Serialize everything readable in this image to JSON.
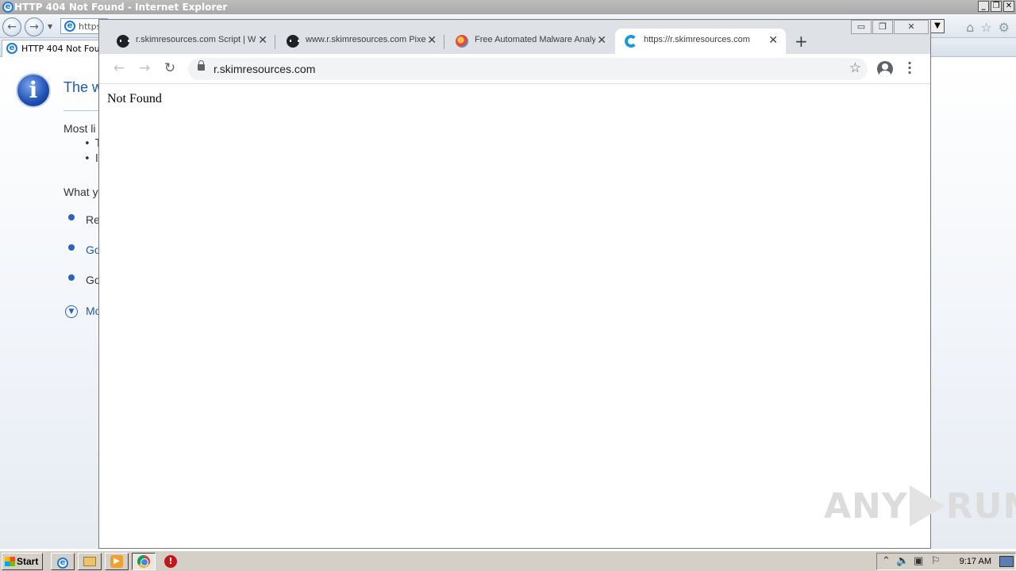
{
  "ie": {
    "window_title": "HTTP 404 Not Found - Internet Explorer",
    "address_value": "https:",
    "tab_label": "HTTP 404 Not Found",
    "heading": "The w",
    "most_likely": "Most li",
    "bullet1": "T",
    "bullet2": "I",
    "what_you": "What y",
    "option1": "Re",
    "option2": "Go",
    "option3": "Go",
    "more": "Mo",
    "minimize_glyph": "_",
    "restore_glyph": "❐",
    "close_glyph": "✕"
  },
  "chrome": {
    "tabs": [
      {
        "label": "r.skimresources.com Script | W",
        "icon": "bot-icon"
      },
      {
        "label": "www.r.skimresources.com Pixe",
        "icon": "bot-icon"
      },
      {
        "label": "Free Automated Malware Analy",
        "icon": "ball-icon"
      },
      {
        "label": "https://r.skimresources.com",
        "icon": "swirl-icon"
      }
    ],
    "tab_close_glyph": "✕",
    "new_tab_glyph": "+",
    "url": "r.skimresources.com",
    "page_text": "Not Found",
    "back_glyph": "←",
    "forward_glyph": "→",
    "reload_glyph": "↻",
    "star_glyph": "☆",
    "menu_glyph": "⋮",
    "win_min": "▭",
    "win_max": "❐",
    "win_close": "✕"
  },
  "watermark": {
    "left": "ANY",
    "right": "RUN"
  },
  "taskbar": {
    "start_label": "Start",
    "clock": "9:17 AM"
  },
  "colors": {
    "ie_heading": "#1f5aa8",
    "chrome_tabstrip": "#dee1e6",
    "omnibox": "#f1f3f4",
    "taskbar": "#d4d0c8"
  }
}
